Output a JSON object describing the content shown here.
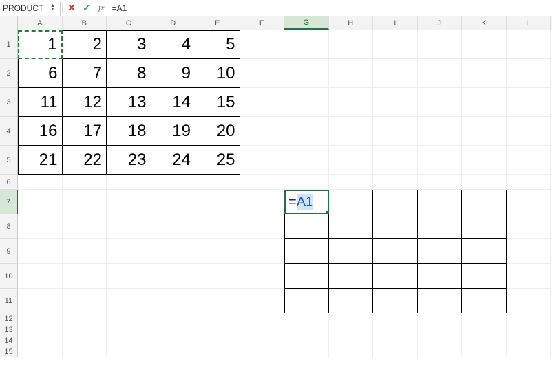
{
  "formula_bar": {
    "name_box": "PRODUCT",
    "cancel_icon": "✕",
    "accept_icon": "✓",
    "fx_label": "fx",
    "formula": "=A1"
  },
  "columns": [
    "A",
    "B",
    "C",
    "D",
    "E",
    "F",
    "G",
    "H",
    "I",
    "J",
    "K",
    "L"
  ],
  "active_col": "G",
  "rows": [
    1,
    2,
    3,
    4,
    5,
    6,
    7,
    8,
    9,
    10,
    11,
    12,
    13,
    14,
    15
  ],
  "active_row": 7,
  "table1": [
    [
      1,
      2,
      3,
      4,
      5
    ],
    [
      6,
      7,
      8,
      9,
      10
    ],
    [
      11,
      12,
      13,
      14,
      15
    ],
    [
      16,
      17,
      18,
      19,
      20
    ],
    [
      21,
      22,
      23,
      24,
      25
    ]
  ],
  "edit_cell": {
    "prefix": "=",
    "ref": "A1"
  },
  "chart_data": {
    "type": "table",
    "title": "Spreadsheet editing (=A1 reference)",
    "tables": [
      {
        "range": "A1:E5",
        "values": [
          [
            1,
            2,
            3,
            4,
            5
          ],
          [
            6,
            7,
            8,
            9,
            10
          ],
          [
            11,
            12,
            13,
            14,
            15
          ],
          [
            16,
            17,
            18,
            19,
            20
          ],
          [
            21,
            22,
            23,
            24,
            25
          ]
        ]
      },
      {
        "range": "G7:K11",
        "values": [
          [
            "=A1",
            "",
            "",
            "",
            ""
          ],
          [
            "",
            "",
            "",
            "",
            ""
          ],
          [
            "",
            "",
            "",
            "",
            ""
          ],
          [
            "",
            "",
            "",
            "",
            ""
          ],
          [
            "",
            "",
            "",
            "",
            ""
          ]
        ]
      }
    ]
  }
}
